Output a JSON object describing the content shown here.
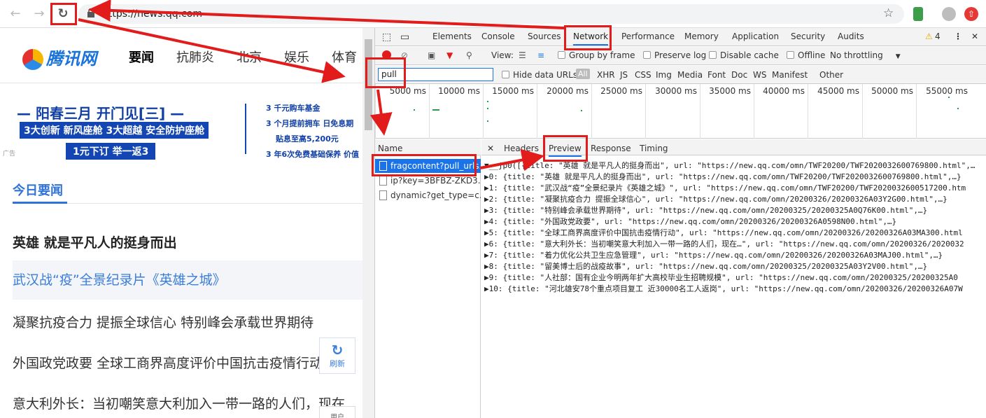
{
  "browser": {
    "url": "https://news.qq.com",
    "back_icon": "arrow-left-icon",
    "forward_icon": "arrow-right-icon",
    "reload_icon": "reload-icon"
  },
  "site": {
    "logo_text": "腾讯网",
    "nav": [
      "要闻",
      "抗肺炎",
      "北京",
      "娱乐",
      "体育"
    ],
    "ad": {
      "line1": "— 阳春三月 开门见[三] —",
      "line2": "3大创新 新风座舱  3大超越 安全防护座舱",
      "line3": "1元下订 举一返3",
      "right": [
        "3 千元购车基金",
        "3 个月提前拥车 日免息期",
        "贴息至高5,200元",
        "3 年6次免费基础保养 价值"
      ],
      "tag": "广告"
    },
    "section_title": "今日要闻",
    "headlines": [
      "英雄 就是平凡人的挺身而出",
      "武汉战“疫”全景纪录片《英雄之城》",
      "凝聚抗疫合力 提振全球信心 特别峰会承载世界期待",
      "外国政党政要 全球工商界高度评价中国抗击疫情行动",
      "意大利外长：当初嘲笑意大利加入一带一路的人们，现在"
    ],
    "refresh_label": "刷新",
    "feedback_label": "用户"
  },
  "devtools": {
    "tabs": [
      "Elements",
      "Console",
      "Sources",
      "Network",
      "Performance",
      "Memory",
      "Application",
      "Security",
      "Audits"
    ],
    "active_tab": "Network",
    "warning_count": "4",
    "toolbar": {
      "view_label": "View:",
      "group_by_frame": "Group by frame",
      "preserve_log": "Preserve log",
      "disable_cache": "Disable cache",
      "offline": "Offline",
      "throttling": "No throttling"
    },
    "filter": {
      "value": "pull",
      "hide_data_urls": "Hide data URLs",
      "all": "All",
      "types": [
        "XHR",
        "JS",
        "CSS",
        "Img",
        "Media",
        "Font",
        "Doc",
        "WS",
        "Manifest",
        "Other"
      ]
    },
    "timeline_ticks": [
      "5000 ms",
      "10000 ms",
      "15000 ms",
      "20000 ms",
      "25000 ms",
      "30000 ms",
      "35000 ms",
      "40000 ms",
      "45000 ms",
      "50000 ms",
      "55000 ms"
    ],
    "requests_header": "Name",
    "requests": [
      "fragcontent?pull_urls...",
      "ip?key=3BFBZ-ZKD3...",
      "dynamic?get_type=c..."
    ],
    "detail_tabs": [
      "Headers",
      "Preview",
      "Response",
      "Timing"
    ],
    "active_detail_tab": "Preview",
    "preview_lines": [
      "▼__jp0([{title: \"英雄 就是平凡人的挺身而出\", url: \"https://new.qq.com/omn/TWF20200/TWF2020032600769800.html\",…",
      "  ▶0: {title: \"英雄 就是平凡人的挺身而出\", url: \"https://new.qq.com/omn/TWF20200/TWF2020032600769800.html\",…}",
      "  ▶1: {title: \"武汉战“疫”全景纪录片《英雄之城》\", url: \"https://new.qq.com/omn/TWF20200/TWF2020032600517200.htm",
      "  ▶2: {title: \"凝聚抗疫合力 提振全球信心\", url: \"https://new.qq.com/omn/20200326/20200326A03Y2G00.html\",…}",
      "  ▶3: {title: \"特别峰会承载世界期待\", url: \"https://new.qq.com/omn/20200325/20200325A0Q76K00.html\",…}",
      "  ▶4: {title: \"外国政党政要\", url: \"https://new.qq.com/omn/20200326/20200326A0598N00.html\",…}",
      "  ▶5: {title: \"全球工商界高度评价中国抗击疫情行动\", url: \"https://new.qq.com/omn/20200326/20200326A03MA300.html",
      "  ▶6: {title: \"意大利外长：当初嘲笑意大利加入一带一路的人们，现在…\", url: \"https://new.qq.com/omn/20200326/2020032",
      "  ▶7: {title: \"着力优化公共卫生应急管理\", url: \"https://new.qq.com/omn/20200326/20200326A03MAJ00.html\",…}",
      "  ▶8: {title: \"留美博士后的战疫故事\", url: \"https://new.qq.com/omn/20200325/20200325A03Y2V00.html\",…}",
      "  ▶9: {title: \"人社部：国有企业今明两年扩大高校毕业生招聘规模\", url: \"https://new.qq.com/omn/20200325/20200325A0",
      "  ▶10: {title: \"河北雄安78个重点项目复工 近30000名工人返岗\", url: \"https://new.qq.com/omn/20200326/20200326A07W"
    ]
  },
  "colors": {
    "annotation": "#e21b1b",
    "accent": "#1a73e8",
    "site_blue": "#2f73d9"
  }
}
